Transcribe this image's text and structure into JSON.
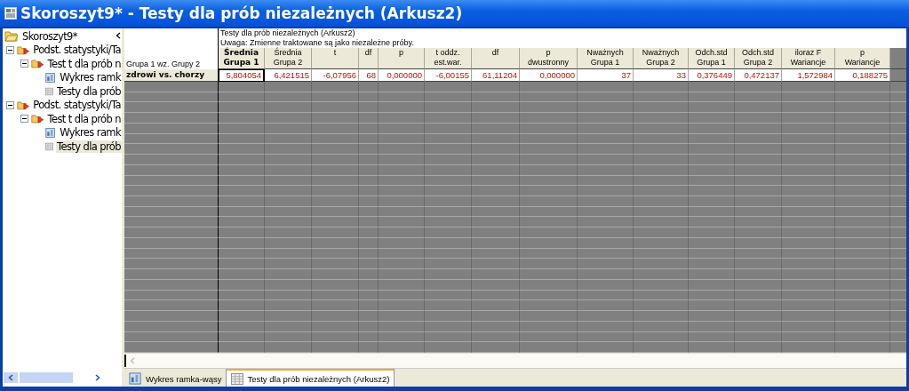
{
  "window": {
    "title": "Skoroszyt9* - Testy dla prób niezależnych (Arkusz2)"
  },
  "tree": {
    "label": "Skoroszyt9*",
    "kind": "workbook",
    "selected": false,
    "children": [
      {
        "label": "Podst. statystyki/Ta",
        "kind": "analysis",
        "expanded": true,
        "selected": false,
        "children": [
          {
            "label": "Test t dla prób n",
            "kind": "analysis",
            "expanded": true,
            "selected": false,
            "children": [
              {
                "label": "Wykres ramk",
                "kind": "graph",
                "selected": false
              },
              {
                "label": "Testy dla prób",
                "kind": "sheet",
                "selected": false
              }
            ]
          }
        ]
      },
      {
        "label": "Podst. statystyki/Ta",
        "kind": "analysis",
        "expanded": true,
        "selected": false,
        "children": [
          {
            "label": "Test t dla prób n",
            "kind": "analysis",
            "expanded": true,
            "selected": false,
            "children": [
              {
                "label": "Wykres ramk",
                "kind": "graph",
                "selected": false
              },
              {
                "label": "Testy dla prób",
                "kind": "sheet",
                "selected": true
              }
            ]
          }
        ]
      }
    ]
  },
  "sheet": {
    "title_lines": [
      "Testy dla prób niezależnych (Arkusz2)",
      "Uwaga: Zmienne traktowane są jako niezależne próby."
    ],
    "row_header_label": "Grupa 1  wz. Grupy 2",
    "columns": [
      {
        "lines": [
          "Średnia",
          "Grupa 1"
        ],
        "selected": true
      },
      {
        "lines": [
          "Średnia",
          "Grupa 2"
        ],
        "selected": false
      },
      {
        "lines": [
          "t"
        ],
        "selected": false
      },
      {
        "lines": [
          "df"
        ],
        "selected": false
      },
      {
        "lines": [
          "p"
        ],
        "selected": false
      },
      {
        "lines": [
          "t oddz.",
          "est.war."
        ],
        "selected": false
      },
      {
        "lines": [
          "df"
        ],
        "selected": false
      },
      {
        "lines": [
          "p",
          "dwustronny"
        ],
        "selected": false
      },
      {
        "lines": [
          "Nważnych",
          "Grupa 1"
        ],
        "selected": false
      },
      {
        "lines": [
          "Nważnych",
          "Grupa 2"
        ],
        "selected": false
      },
      {
        "lines": [
          "Odch.std",
          "Grupa 1"
        ],
        "selected": false
      },
      {
        "lines": [
          "Odch.std",
          "Grupa 2"
        ],
        "selected": false
      },
      {
        "lines": [
          "iloraz F",
          "Wariancje"
        ],
        "selected": false
      },
      {
        "lines": [
          "p",
          "Wariancje"
        ],
        "selected": false
      }
    ],
    "rows": [
      {
        "label": "zdrowi vs.   chorzy",
        "cells": [
          {
            "value": "5,804054",
            "focused": true
          },
          {
            "value": "6,421515",
            "focused": false
          },
          {
            "value": "-6,07956",
            "focused": false
          },
          {
            "value": "68",
            "focused": false
          },
          {
            "value": "0,000000",
            "focused": false
          },
          {
            "value": "-6,00155",
            "focused": false
          },
          {
            "value": "61,11204",
            "focused": false
          },
          {
            "value": "0,000000",
            "focused": false
          },
          {
            "value": "37",
            "focused": false
          },
          {
            "value": "33",
            "focused": false
          },
          {
            "value": "0,376449",
            "focused": false
          },
          {
            "value": "0,472137",
            "focused": false
          },
          {
            "value": "1,572984",
            "focused": false
          },
          {
            "value": "0,188275",
            "focused": false
          }
        ]
      }
    ]
  },
  "tabs": [
    {
      "label": "Wykres ramka-wąsy",
      "kind": "graph",
      "selected": false
    },
    {
      "label": "Testy dla prób niezależnych (Arkusz2)",
      "kind": "sheet",
      "selected": true
    }
  ]
}
